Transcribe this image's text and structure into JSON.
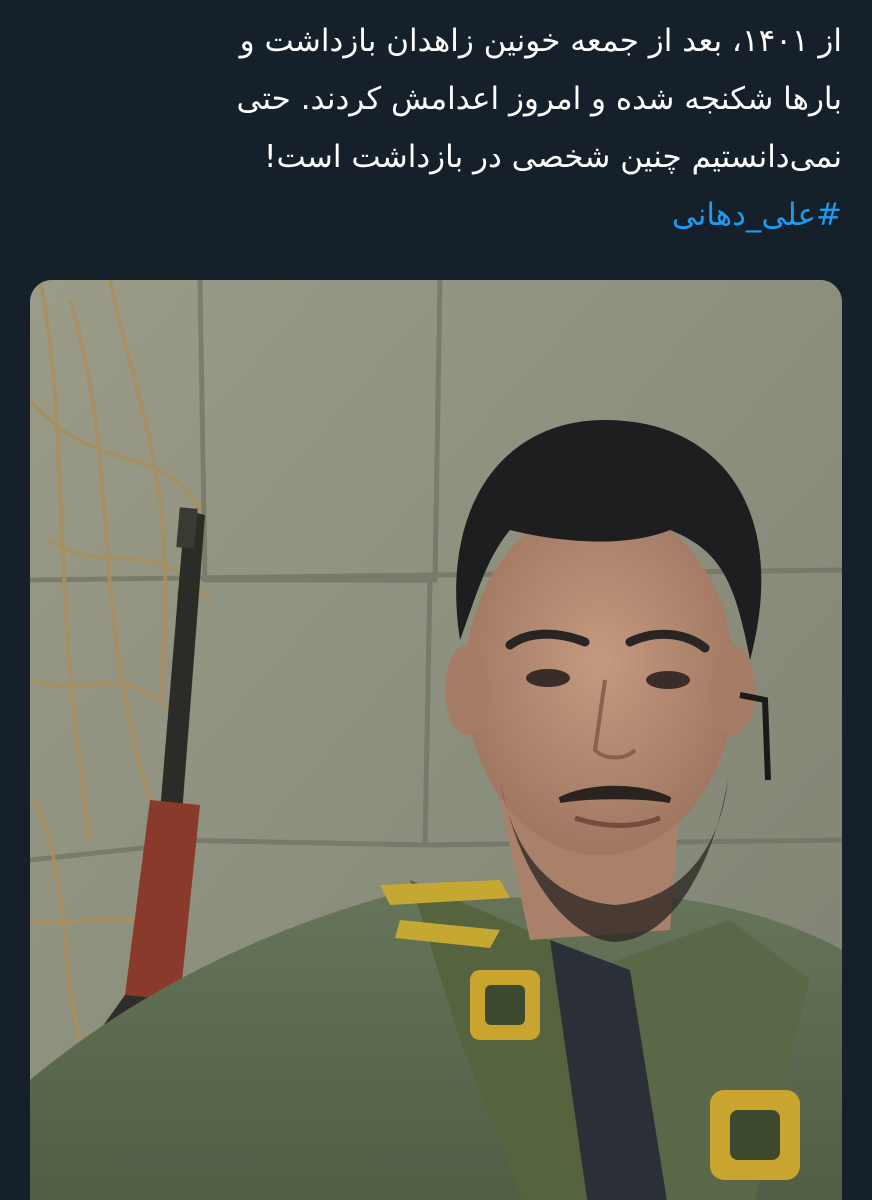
{
  "tweet": {
    "text_lines": [
      "از ۱۴۰۱، بعد از جمعه خونین زاهدان بازداشت و",
      "بارها شکنجه شده و امروز اعدامش کردند. حتی",
      "نمی‌دانستیم چنین شخصی در بازداشت است!"
    ],
    "hashtag": "#علی_دهانی"
  },
  "media": {
    "alt": "photo",
    "colors": {
      "wall": "#8e9280",
      "uniform": "#5d6b4e",
      "rifle_stock": "#8a3a2a",
      "hair": "#1e1d1f",
      "skin": "#b88d75"
    }
  },
  "theme": {
    "background": "#15202b",
    "text": "#ffffff",
    "link": "#1d9bf0"
  }
}
